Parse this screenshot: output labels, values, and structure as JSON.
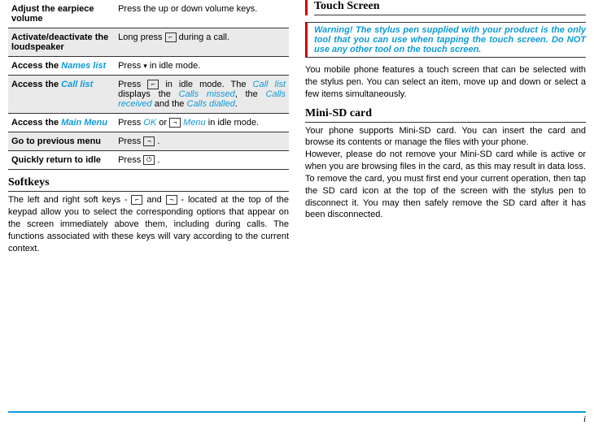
{
  "table": {
    "rows": [
      {
        "label": "Adjust the earpiece volume",
        "value_pre": "Press the up or down volume keys.",
        "value_post": ""
      },
      {
        "label": "Activate/deactivate the loudspeaker",
        "value_pre": "Long press ",
        "icon": "L",
        "value_post": " during a call."
      },
      {
        "label_pre": "Access the ",
        "label_colored": "Names list",
        "value_pre": "Press ",
        "icon": "▾",
        "value_post": " in idle mode."
      },
      {
        "label_pre": "Access the ",
        "label_colored": "Call list",
        "value_pre": "Press ",
        "icon": "L",
        "value_post": " in idle mode. The ",
        "c1": "Call list",
        "t1": " displays the ",
        "c2": "Calls missed",
        "t2": ", the ",
        "c3": "Calls received",
        "t3": " and the ",
        "c4": "Calls dialled",
        "t4": "."
      },
      {
        "label_pre": "Access the ",
        "label_colored": "Main Menu",
        "value_pre": "Press ",
        "c_ok": "OK",
        "mid": " or ",
        "icon": "R",
        "sp": " ",
        "c_menu": "Menu",
        "value_post": " in idle mode."
      },
      {
        "label": "Go to previous menu",
        "value_pre": "Press ",
        "icon": "R",
        "value_post": " ."
      },
      {
        "label": "Quickly return to idle",
        "value_pre": "Press ",
        "icon": "R",
        "value_post": " ."
      }
    ]
  },
  "softkeys": {
    "heading": "Softkeys",
    "body_pre": "The left and right soft keys - ",
    "body_mid": " and ",
    "body_post": " - located at the top of the keypad allow you to select the corresponding options that appear on the screen immediately above them, including during calls. The functions associated with these keys will vary according to the current context."
  },
  "touch": {
    "heading": "Touch Screen",
    "warning": "Warning! The stylus pen supplied with your product is the only tool that you can use when tapping the touch screen.  Do NOT use any other tool on the touch screen.",
    "body": "You mobile phone features a touch screen that can be selected with the stylus pen.  You can select an item, move up and down or select a few items simultaneously."
  },
  "minisd": {
    "heading": "Mini-SD card",
    "body": "Your phone supports Mini-SD card.  You can insert the card and browse its contents or manage the files with your phone.\nHowever, please do not remove your Mini-SD card while is active or when you are browsing files in the card, as this may result in data loss.  To remove the card, you must first end your current operation, then tap the SD card icon at the top of the screen with the stylus pen to disconnect it.  You may then safely remove the SD card after it has been disconnected."
  },
  "footer": "i"
}
